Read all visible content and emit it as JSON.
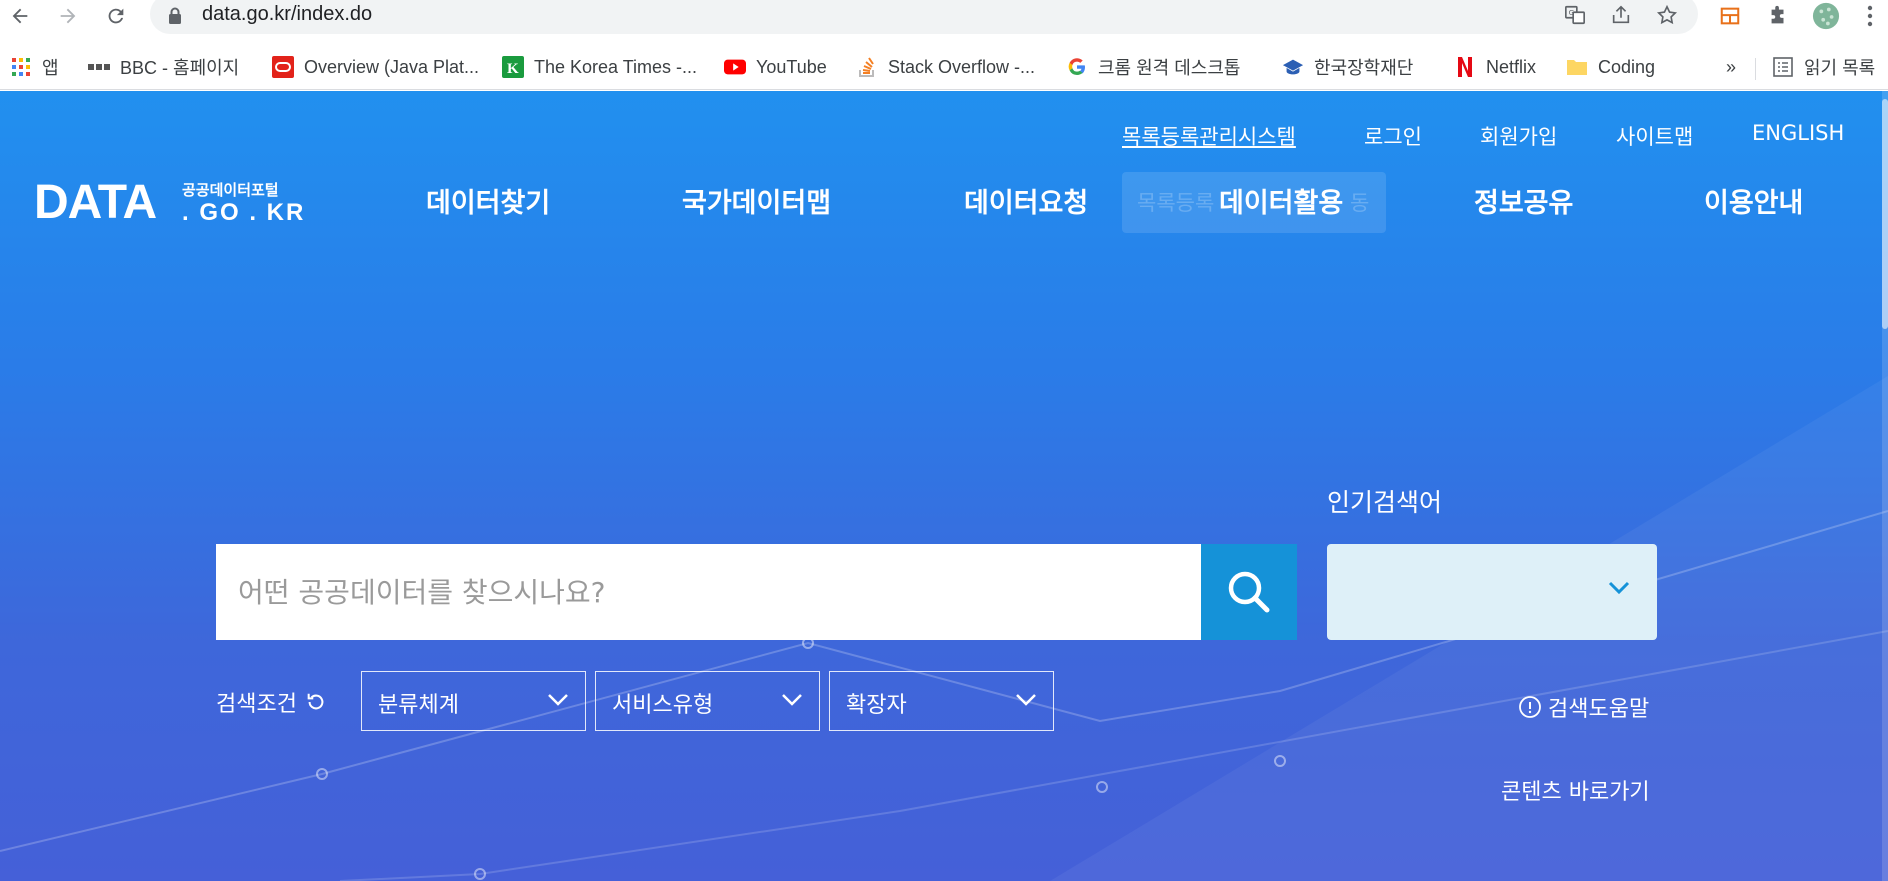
{
  "browser": {
    "url": "data.go.kr/index.do",
    "icons": [
      "back-icon",
      "forward-icon",
      "reload-icon",
      "lock-icon",
      "translate-icon",
      "share-icon",
      "star-icon",
      "extension-icon",
      "puzzle-icon",
      "profile-avatar",
      "menu-kebab-icon"
    ]
  },
  "bookmarks": [
    {
      "label": "앱"
    },
    {
      "label": "BBC - 홈페이지"
    },
    {
      "label": "Overview (Java Plat..."
    },
    {
      "label": "The Korea Times -..."
    },
    {
      "label": "YouTube"
    },
    {
      "label": "Stack Overflow -..."
    },
    {
      "label": "크롬 원격 데스크톱"
    },
    {
      "label": "한국장학재단"
    },
    {
      "label": "Netflix"
    },
    {
      "label": "Coding"
    }
  ],
  "bookmarks_more": "»",
  "reading_list": "읽기 목록",
  "site": {
    "utility_links": [
      "목록등록관리시스템",
      "로그인",
      "회원가입",
      "사이트맵",
      "ENGLISH"
    ],
    "logo": {
      "main": "DATA",
      "sub_top": "공공데이터포털",
      "sub_bottom": ". GO . KR"
    },
    "main_nav": [
      "데이터찾기",
      "국가데이터맵",
      "데이터요청",
      "데이터활용",
      "정보공유",
      "이용안내"
    ],
    "nav_ghost_left": "목록등록",
    "nav_ghost_right": "동",
    "search": {
      "placeholder": "어떤 공공데이터를 찾으시나요?",
      "value": ""
    },
    "popular": {
      "label": "인기검색어",
      "value": ""
    },
    "conditions": {
      "label": "검색조건",
      "filters": [
        "분류체계",
        "서비스유형",
        "확장자"
      ]
    },
    "help_link": "검색도움말",
    "content_link": "콘텐츠 바로가기"
  },
  "colors": {
    "page_top": "#2190ef",
    "page_bottom": "#4560d8",
    "search_button": "#1592d8",
    "popular_bg": "#def0f8"
  }
}
